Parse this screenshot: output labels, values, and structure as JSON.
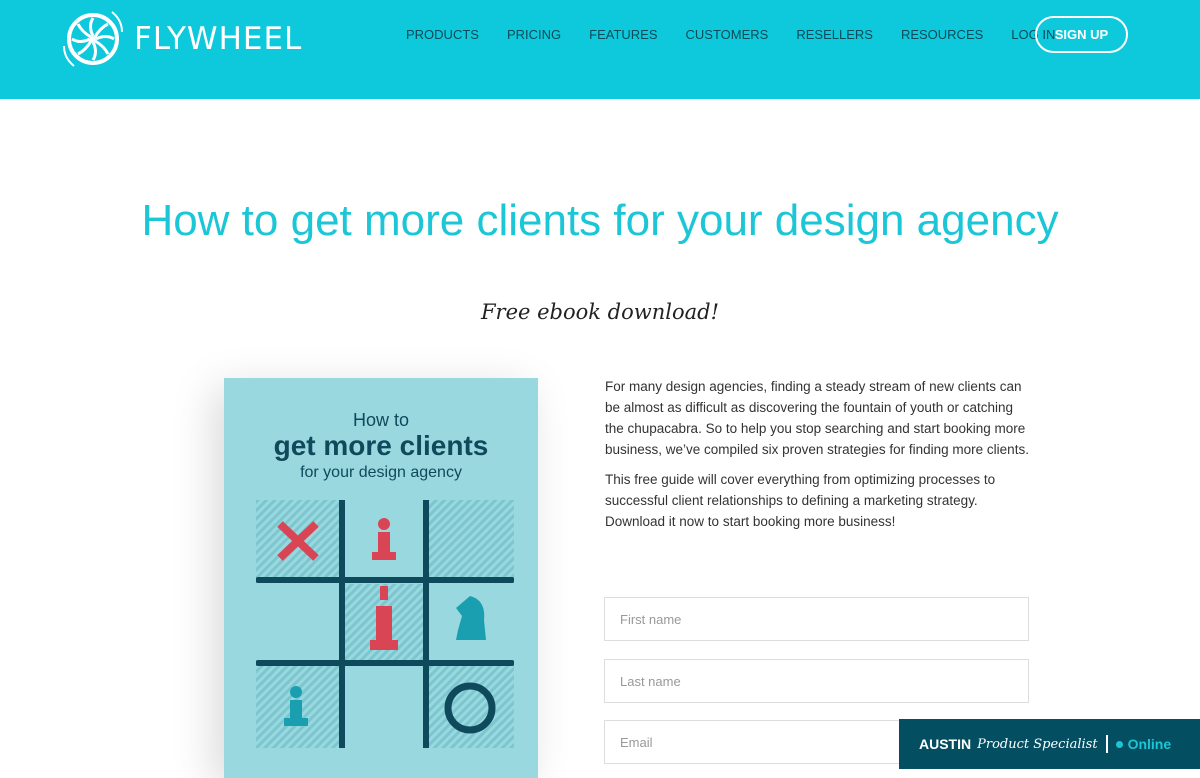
{
  "header": {
    "brand": "FLYWHEEL",
    "nav": [
      "PRODUCTS",
      "PRICING",
      "FEATURES",
      "CUSTOMERS",
      "RESELLERS",
      "RESOURCES",
      "LOG IN"
    ],
    "signup": "SIGN UP"
  },
  "hero": {
    "title": "How to get more clients for your design agency",
    "subtitle": "Free ebook download!"
  },
  "book": {
    "line1": "How to",
    "line2": "get more clients",
    "line3": "for your design agency"
  },
  "copy": {
    "p1": "For many design agencies, finding a steady stream of new clients can be almost as difficult as discovering the fountain of youth or catching the chupacabra. So to help you stop searching and start booking more business, we’ve compiled six proven strategies for finding more clients.",
    "p2": "This free guide will cover everything from optimizing processes to successful client relationships to defining a marketing strategy. Download it now to start booking more business!"
  },
  "form": {
    "first": "First name",
    "last": "Last name",
    "email": "Email"
  },
  "chat": {
    "name": "AUSTIN",
    "role": "Product Specialist",
    "status": "Online"
  },
  "colors": {
    "brand": "#0ec9db",
    "dark": "#034f61"
  }
}
